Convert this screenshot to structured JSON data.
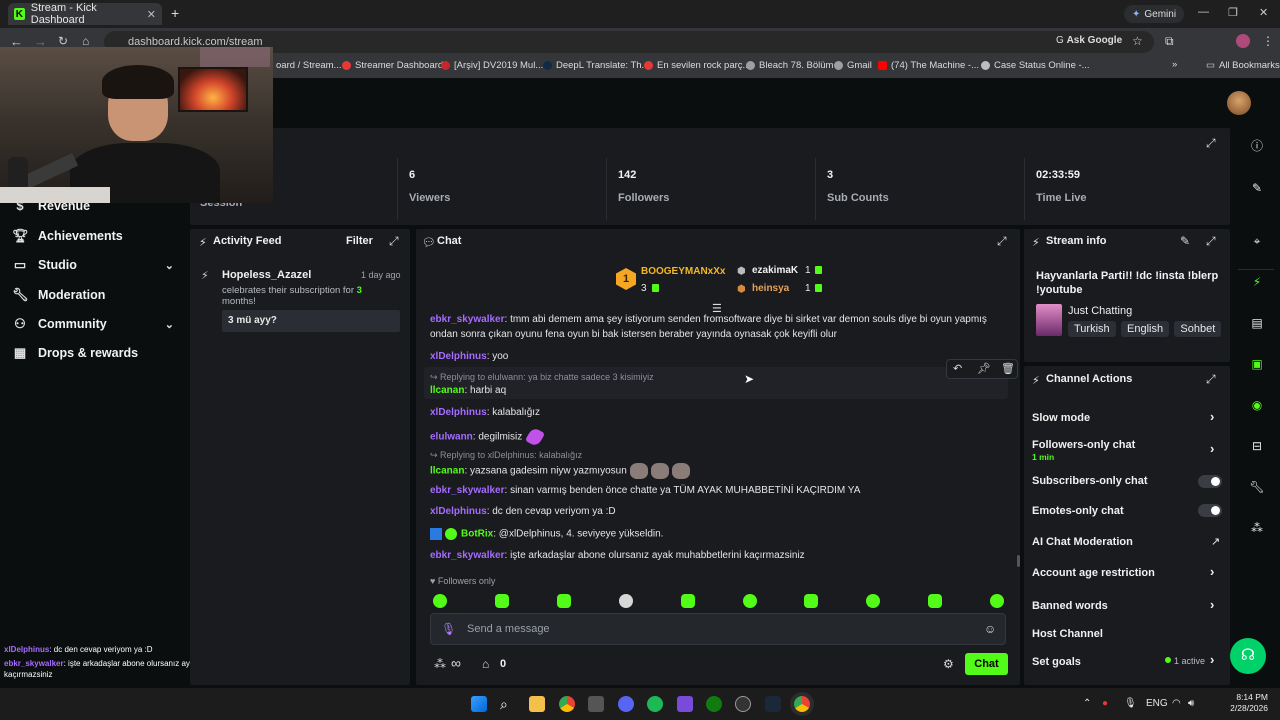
{
  "browser": {
    "tab_title": "Stream - Kick Dashboard",
    "gemini_label": "Gemini",
    "url": "dashboard.kick.com/stream",
    "ask_google": "Ask Google",
    "bookmarks": [
      "oard / Stream...",
      "Streamer Dashboard",
      "[Arşiv] DV2019 Mul...",
      "DeepL Translate: Th...",
      "En sevilen rock parç...",
      "Bleach 78. Bölüm",
      "Gmail",
      "(74) The Machine -...",
      "Case Status Online -..."
    ],
    "all_bookmarks": "All Bookmarks"
  },
  "sidebar": {
    "items": [
      {
        "label": "Revenue"
      },
      {
        "label": "Achievements"
      },
      {
        "label": "Studio"
      },
      {
        "label": "Moderation"
      },
      {
        "label": "Community"
      },
      {
        "label": "Drops & rewards"
      }
    ],
    "overlay_chat": [
      {
        "user": "xlDelphinus",
        "text": ": dc den cevap veriyom ya :D"
      },
      {
        "user": "ebkr_skywalker",
        "text": ": işte arkadaşlar abone olursanız ayak muhabbetlerini kaçırmazsiniz"
      }
    ]
  },
  "stats": {
    "session_label": "Session",
    "items": [
      {
        "value": "6",
        "label": "Viewers"
      },
      {
        "value": "142",
        "label": "Followers"
      },
      {
        "value": "3",
        "label": "Sub Counts"
      },
      {
        "value": "02:33:59",
        "label": "Time Live"
      }
    ]
  },
  "activity": {
    "title": "Activity Feed",
    "filter": "Filter",
    "event_user": "Hopeless_Azazel",
    "event_time": "1 day ago",
    "event_text_a": "celebrates their subscription for ",
    "event_months": "3",
    "event_text_b": " months!",
    "event_message": "3 mü ayy?"
  },
  "chat": {
    "title": "Chat",
    "leaders": [
      {
        "rank": "1",
        "name": "BOOGEYMANxXx",
        "count": "3"
      },
      {
        "name": "ezakimaK",
        "count": "1"
      },
      {
        "name": "heinsya",
        "count": "1"
      }
    ],
    "messages": [
      {
        "user": "ebkr_skywalker",
        "text": ": tmm abi demem ama şey istiyorum senden fromsoftware diye bi sirket var demon souls diye bi oyun yapmış",
        "line2": "ondan sonra çıkan oyunu fena oyun bi bak istersen beraber yayında oynasak çok keyifli olur"
      },
      {
        "user": "xlDelphinus",
        "text": ": yoo"
      },
      {
        "reply": "Replying to elulwann: ya biz chatte sadece 3 kisimiyiz",
        "user": "llcanan",
        "text": ": harbi aq"
      },
      {
        "user": "xlDelphinus",
        "text": ": kalabalığız"
      },
      {
        "user": "elulwann",
        "text": ": degilmisiz"
      },
      {
        "reply": "Replying to xlDelphinus: kalabalığız",
        "user": "llcanan",
        "text": ": yazsana gadesim niyw yazmıyosun"
      },
      {
        "user": "ebkr_skywalker",
        "text": ": sinan varmış benden önce chatte ya TÜM AYAK MUHABBETİNİ KAÇIRDIM YA"
      },
      {
        "user": "xlDelphinus",
        "text": ": dc den cevap veriyom ya :D"
      },
      {
        "user": "BotRix",
        "text": ": @xlDelphinus, 4. seviyeye yükseldin."
      },
      {
        "user": "ebkr_skywalker",
        "text": ": işte arkadaşlar abone olursanız ayak muhabbetlerini kaçırmazsiniz"
      }
    ],
    "followers_only": "Followers only",
    "input_placeholder": "Send a message",
    "infinity": "∞",
    "points": "0",
    "send_button": "Chat"
  },
  "stream_info": {
    "title": "Stream info",
    "stream_title": "Hayvanlarla Parti!! !dc !insta !blerp !youtube",
    "category": "Just Chatting",
    "tags": [
      "Turkish",
      "English",
      "Sohbet"
    ]
  },
  "channel_actions": {
    "title": "Channel Actions",
    "slow_mode": "Slow mode",
    "followers_only": "Followers-only chat",
    "followers_only_sub": "1 min",
    "subscribers_only": "Subscribers-only chat",
    "emotes_only": "Emotes-only chat",
    "ai_moderation": "AI Chat Moderation",
    "account_age": "Account age restriction",
    "banned_words": "Banned words",
    "host_channel": "Host Channel",
    "set_goals": "Set goals",
    "goals_status": "1 active"
  },
  "taskbar": {
    "lang": "ENG",
    "time": "8:14 PM",
    "date": "2/28/2026"
  },
  "colors": {
    "accent": "#53fc18",
    "purple_user": "#a66bff",
    "panel": "#191b1f",
    "background": "#0b0e0f"
  }
}
